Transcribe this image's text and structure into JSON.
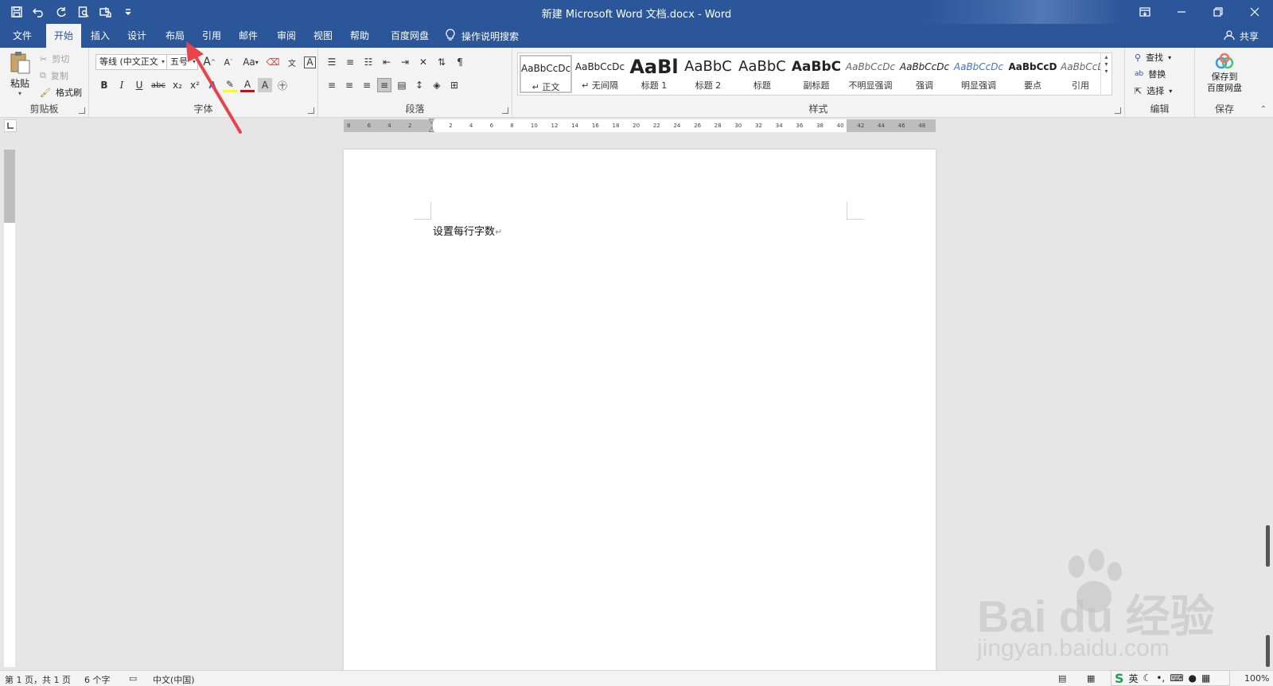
{
  "window": {
    "title": "新建 Microsoft Word 文档.docx  -  Word",
    "qat": [
      "save-icon",
      "undo-icon",
      "redo-icon",
      "print-preview-icon",
      "touch-mode-icon",
      "customize-qat-icon"
    ]
  },
  "tabs": [
    {
      "label": "文件"
    },
    {
      "label": "开始"
    },
    {
      "label": "插入"
    },
    {
      "label": "设计"
    },
    {
      "label": "布局"
    },
    {
      "label": "引用"
    },
    {
      "label": "邮件"
    },
    {
      "label": "审阅"
    },
    {
      "label": "视图"
    },
    {
      "label": "帮助"
    },
    {
      "label": "百度网盘"
    }
  ],
  "active_tab": "开始",
  "tell_me": "操作说明搜索",
  "share": "共享",
  "clipboard": {
    "paste": "粘贴",
    "cut": "剪切",
    "copy": "复制",
    "format_painter": "格式刷",
    "label": "剪贴板"
  },
  "font": {
    "name": "等线 (中文正文",
    "size": "五号",
    "label": "字体",
    "grow": "A",
    "shrink": "A",
    "change_case": "Aa",
    "bold": "B",
    "italic": "I",
    "underline": "U",
    "strike": "abc",
    "sub": "x₂",
    "sup": "x²",
    "color_letter": "A"
  },
  "paragraph": {
    "label": "段落"
  },
  "styles": {
    "label": "样式",
    "items": [
      {
        "preview": "AaBbCcDc",
        "name": "↵ 正文"
      },
      {
        "preview": "AaBbCcDc",
        "name": "↵ 无间隔"
      },
      {
        "preview": "AaBl",
        "name": "标题 1"
      },
      {
        "preview": "AaBbC",
        "name": "标题 2"
      },
      {
        "preview": "AaBbC",
        "name": "标题"
      },
      {
        "preview": "AaBbC",
        "name": "副标题"
      },
      {
        "preview": "AaBbCcDc",
        "name": "不明显强调"
      },
      {
        "preview": "AaBbCcDc",
        "name": "强调"
      },
      {
        "preview": "AaBbCcDc",
        "name": "明显强调"
      },
      {
        "preview": "AaBbCcD",
        "name": "要点"
      },
      {
        "preview": "AaBbCcDc",
        "name": "引用"
      }
    ]
  },
  "editing": {
    "find": "查找",
    "replace": "替换",
    "select": "选择",
    "label": "编辑"
  },
  "save_group": {
    "button": "保存到\n百度网盘",
    "label": "保存"
  },
  "ruler_ticks": [
    "8",
    "6",
    "4",
    "2",
    "",
    "2",
    "4",
    "6",
    "8",
    "10",
    "12",
    "14",
    "16",
    "18",
    "20",
    "22",
    "24",
    "26",
    "28",
    "30",
    "32",
    "34",
    "36",
    "38",
    "40",
    "42",
    "44",
    "46",
    "48"
  ],
  "document": {
    "text": "设置每行字数",
    "mark": "↵"
  },
  "status": {
    "page": "第 1 页，共 1 页",
    "words": "6 个字",
    "language": "中文(中国)",
    "zoom": "100%"
  },
  "ime": {
    "lang": "英"
  },
  "watermark": {
    "brand": "Bai  du 经验",
    "url": "jingyan.baidu.com"
  },
  "colors": {
    "brand": "#2b579a",
    "ribbon": "#f3f3f3",
    "arrow": "#e8424a"
  }
}
